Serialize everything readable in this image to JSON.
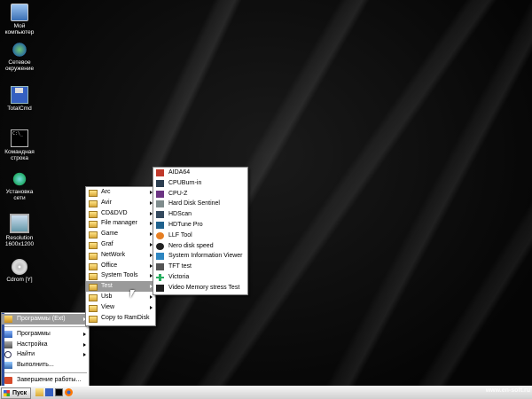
{
  "desktop": {
    "icons": [
      {
        "name": "my-computer",
        "label": "Мой компьютер",
        "icon": "computer-icon"
      },
      {
        "name": "network",
        "label": "Сетевое окружение",
        "icon": "network-icon"
      },
      {
        "name": "totalcmd",
        "label": "TotalCmd",
        "icon": "floppy-icon"
      },
      {
        "name": "cmd",
        "label": "Командная строка",
        "icon": "cmd-icon"
      },
      {
        "name": "network-setup",
        "label": "Установка сети",
        "icon": "network-setup-icon"
      },
      {
        "name": "resolution",
        "label": "Resolution 1600x1200",
        "icon": "monitor-icon"
      },
      {
        "name": "cdrom",
        "label": "Cdrom [Y]",
        "icon": "cd-icon"
      }
    ]
  },
  "start_menu": {
    "items": [
      {
        "label": "Программы (Ext)",
        "icon": "programs-ext-icon",
        "submenu": true
      },
      {
        "label": "Программы",
        "icon": "programs-icon",
        "submenu": true
      },
      {
        "label": "Настройка",
        "icon": "settings-icon",
        "submenu": true
      },
      {
        "label": "Найти",
        "icon": "search-icon",
        "submenu": true
      },
      {
        "label": "Выполнить...",
        "icon": "run-icon",
        "submenu": false
      },
      {
        "label": "Завершение работы...",
        "icon": "shutdown-icon",
        "submenu": false
      }
    ]
  },
  "programs_ext_menu": {
    "items": [
      {
        "label": "Arc",
        "submenu": true
      },
      {
        "label": "Avir",
        "submenu": true
      },
      {
        "label": "CD&DVD",
        "submenu": true
      },
      {
        "label": "File manager",
        "submenu": true
      },
      {
        "label": "Game",
        "submenu": true
      },
      {
        "label": "Graf",
        "submenu": true
      },
      {
        "label": "NetWork",
        "submenu": true
      },
      {
        "label": "Office",
        "submenu": true
      },
      {
        "label": "System Tools",
        "submenu": true
      },
      {
        "label": "Test",
        "submenu": true,
        "highlighted": true
      },
      {
        "label": "Usb",
        "submenu": true
      },
      {
        "label": "View",
        "submenu": true
      },
      {
        "label": "Copy to RamDisk",
        "submenu": false
      }
    ]
  },
  "test_menu": {
    "items": [
      {
        "label": "AIDA64",
        "icon": "aida64-icon",
        "color": "#c0392b"
      },
      {
        "label": "CPUBurn-in",
        "icon": "cpuburn-icon",
        "color": "#2c3e50"
      },
      {
        "label": "CPU-Z",
        "icon": "cpuz-icon",
        "color": "#6c3483"
      },
      {
        "label": "Hard Disk Sentinel",
        "icon": "hdsentinel-icon",
        "color": "#7f8c8d"
      },
      {
        "label": "HDScan",
        "icon": "hdscan-icon",
        "color": "#34495e"
      },
      {
        "label": "HDTune Pro",
        "icon": "hdtune-icon",
        "color": "#1f618d"
      },
      {
        "label": "LLF Tool",
        "icon": "llf-icon",
        "color": "#e67e22"
      },
      {
        "label": "Nero disk speed",
        "icon": "nero-icon",
        "color": "#212121"
      },
      {
        "label": "System Information Viewer",
        "icon": "siv-icon",
        "color": "#2e86c1"
      },
      {
        "label": "TFT test",
        "icon": "tft-icon",
        "color": "#555555"
      },
      {
        "label": "Victoria",
        "icon": "victoria-icon",
        "color": "#27ae60"
      },
      {
        "label": "Video Memory stress Test",
        "icon": "vmt-icon",
        "color": "#212121"
      }
    ]
  },
  "taskbar": {
    "start_label": "Пуск",
    "tray_text": "www.en"
  },
  "watermark": "www.en-soft.ru"
}
